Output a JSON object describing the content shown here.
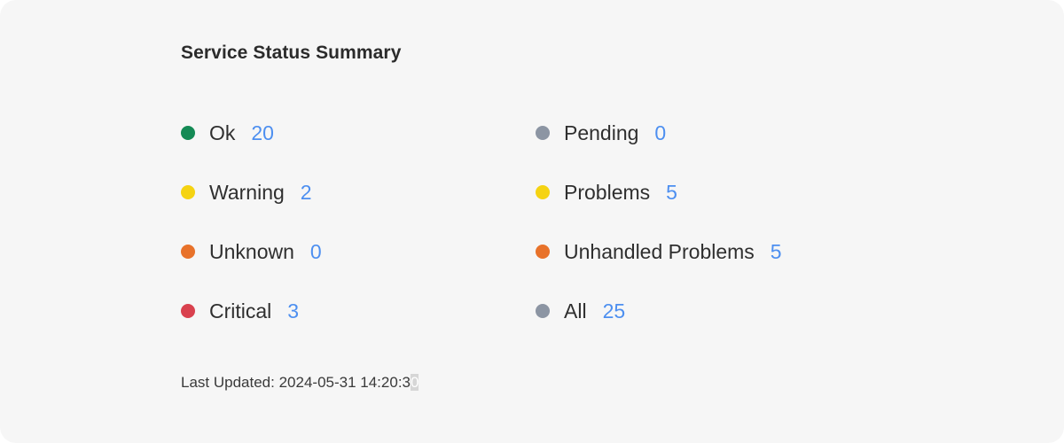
{
  "panel": {
    "title": "Service Status Summary",
    "last_updated_label": "Last Updated:",
    "last_updated_value": "2024-05-31 14:20:3",
    "last_updated_selected": "0"
  },
  "statuses": [
    {
      "label": "Ok",
      "count": "20",
      "color": "#148a55"
    },
    {
      "label": "Warning",
      "count": "2",
      "color": "#f5d312"
    },
    {
      "label": "Unknown",
      "count": "0",
      "color": "#e8722a"
    },
    {
      "label": "Critical",
      "count": "3",
      "color": "#d9414e"
    },
    {
      "label": "Pending",
      "count": "0",
      "color": "#8c95a3"
    },
    {
      "label": "Problems",
      "count": "5",
      "color": "#f5d312"
    },
    {
      "label": "Unhandled Problems",
      "count": "5",
      "color": "#e8722a"
    },
    {
      "label": "All",
      "count": "25",
      "color": "#8c95a3"
    }
  ],
  "colors": {
    "count_text": "#4d8ff0",
    "panel_bg": "#f6f6f6"
  }
}
